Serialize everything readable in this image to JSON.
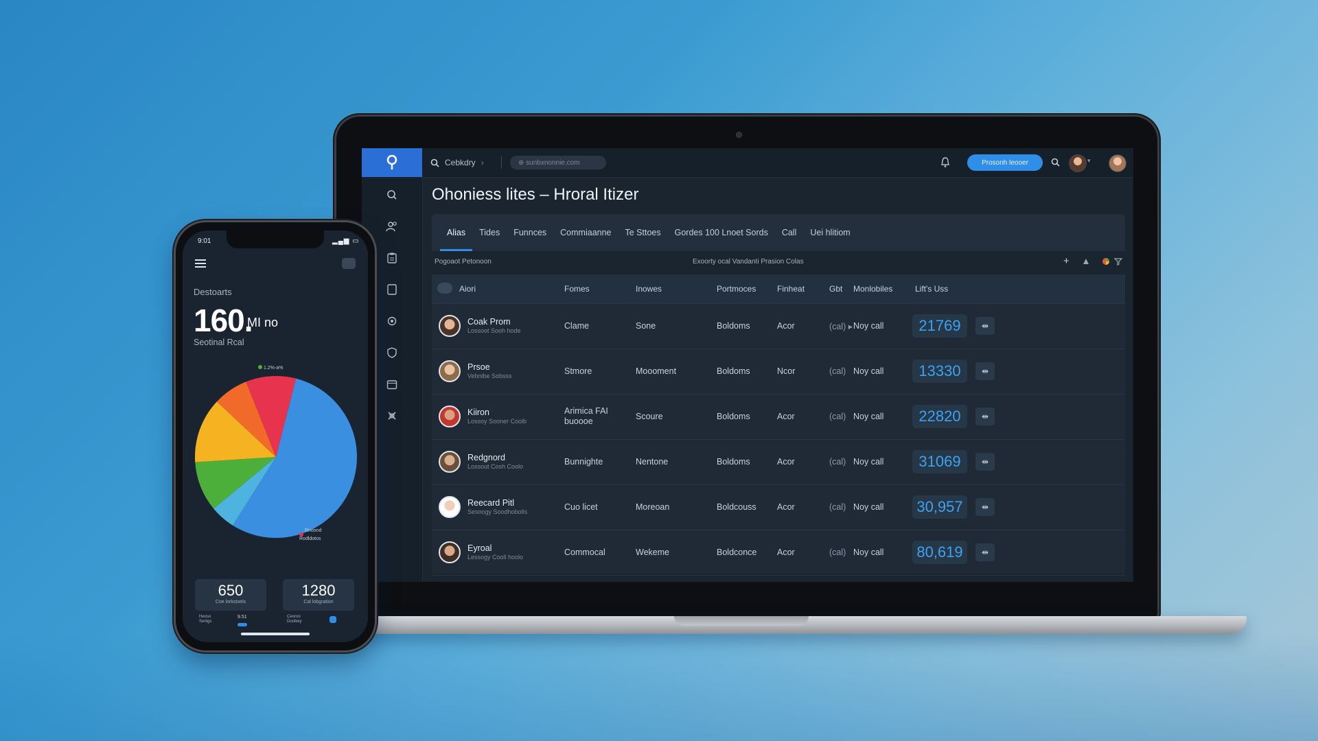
{
  "laptop": {
    "breadcrumb": "Cebkdry",
    "url": "⊕ sunbxnonnie.com",
    "primary_button": "Prosonh leooer",
    "page_title": "Ohoniess lites – Hroral Itizer",
    "tabs": [
      "Alias",
      "Tides",
      "Funnces",
      "Commiaanne",
      "Te Sttoes",
      "Gordes 100 Lnoet Sords",
      "Call",
      "Uei hlitiom"
    ],
    "active_tab": 0,
    "toolbar_left": "Pogoaot Petonoon",
    "toolbar_center": "Exoorty ocal Vandanti Prasion Colas",
    "columns": [
      "Aiori",
      "Fomes",
      "Inowes",
      "Portmoces",
      "Finheat",
      "Gbt",
      "Monlobiles",
      "Lift's Uss"
    ],
    "rows": [
      {
        "name": "Coak Prom",
        "sub": "Lossoot Sooh hode",
        "c1": "Clame",
        "c2": "Sone",
        "c3": "Boldoms",
        "c4": "Acor",
        "c5": "(cal) ▸",
        "c6": "Noy call",
        "value": "21769",
        "avatar_skin": "#e3b597",
        "avatar_hair": "#4a3428"
      },
      {
        "name": "Prsoe",
        "sub": "Vebnibe Sobsss",
        "c1": "Stmore",
        "c2": "Moooment",
        "c3": "Boldoms",
        "c4": "Ncor",
        "c5": "(cal)",
        "c6": "Noy call",
        "value": "13330",
        "avatar_skin": "#e7c2a3",
        "avatar_hair": "#8c6a4a"
      },
      {
        "name": "Kiiron",
        "sub": "Lossoy Sooner Coolb",
        "c1": "Arimica FAI\nbuoooe",
        "c2": "Scoure",
        "c3": "Boldoms",
        "c4": "Acor",
        "c5": "(cal)",
        "c6": "Noy call",
        "value": "22820",
        "avatar_skin": "#d9a183",
        "avatar_hair": "#c4372e"
      },
      {
        "name": "Redgnord",
        "sub": "Lossout Cosh Coolo",
        "c1": "Bunnighte",
        "c2": "Nentone",
        "c3": "Boldoms",
        "c4": "Acor",
        "c5": "(cal)",
        "c6": "Noy call",
        "value": "31069",
        "avatar_skin": "#d9b08e",
        "avatar_hair": "#6b4f3b"
      },
      {
        "name": "Reecard Pitl",
        "sub": "Sesoogy Soodhobolls",
        "c1": "Cuo licet",
        "c2": "Moreoan",
        "c3": "Boldcouss",
        "c4": "Acor",
        "c5": "(cal)",
        "c6": "Noy call",
        "value": "30,957",
        "avatar_skin": "#f0cfb6",
        "avatar_hair": "#ffffff"
      },
      {
        "name": "Eyroal",
        "sub": "Lessogy Cooll hoolo",
        "c1": "Commocal",
        "c2": "Wekeme",
        "c3": "Boldconce",
        "c4": "Acor",
        "c5": "(cal)",
        "c6": "Noy call",
        "value": "80,619",
        "avatar_skin": "#d7a98a",
        "avatar_hair": "#3f2e25"
      }
    ],
    "row_button": "⇹"
  },
  "phone": {
    "time": "9:01",
    "title": "Destoarts",
    "big_value": "160.",
    "unit": "MI no",
    "subtitle": "Seotinal Rcal",
    "legend_top": "1.2%-a%",
    "legend_bottom": "Rnoond\nRodldotos",
    "pie": {
      "slices": [
        {
          "label": "blue",
          "color": "#3a8fe0",
          "value": 55
        },
        {
          "label": "light-blue",
          "color": "#4fb3e0",
          "value": 5
        },
        {
          "label": "green",
          "color": "#4caf3a",
          "value": 10
        },
        {
          "label": "yellow",
          "color": "#f5b221",
          "value": 13
        },
        {
          "label": "orange",
          "color": "#f26a2a",
          "value": 7
        },
        {
          "label": "red",
          "color": "#e8334f",
          "value": 10
        }
      ]
    },
    "card_left": {
      "value": "650",
      "label": "Coe lorkstoels"
    },
    "card_right": {
      "value": "1280",
      "label": "Cal lobgration"
    },
    "footer_left": "Heoso\nSerligs",
    "footer_mid": "9.51",
    "footer_right": "Ceoroo\nDoolkey"
  }
}
